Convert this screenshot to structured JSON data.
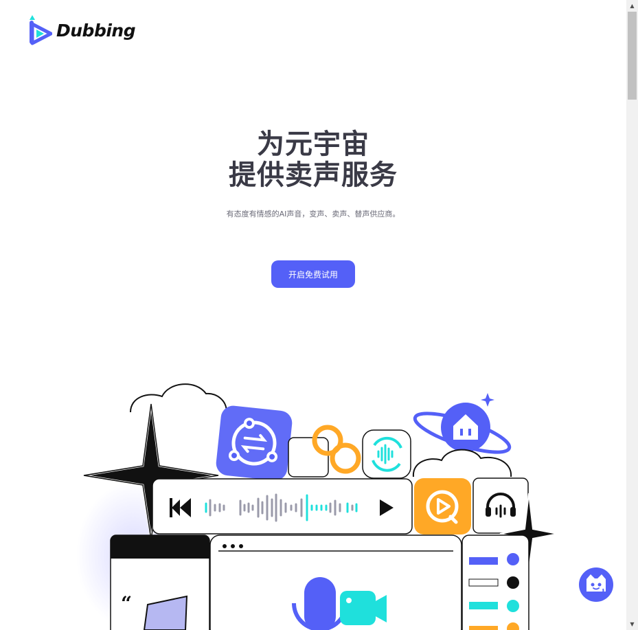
{
  "brand": {
    "name": "Dubbing"
  },
  "hero": {
    "title_line1": "为元宇宙",
    "title_line2": "提供卖声服务",
    "subtitle": "有态度有情感的AI声音，变声、卖声、替声供应商。",
    "cta_label": "开启免费试用"
  },
  "colors": {
    "brand": "#5460f7",
    "text_dark": "#3a3a46",
    "cyan": "#1fe0dc",
    "orange": "#ffa826",
    "black": "#111111"
  },
  "icons": {
    "logo": "play-triangle-logo",
    "convert": "swap-circle-icon",
    "link": "infinity-link-icon",
    "voice": "voice-refresh-icon",
    "home": "planet-home-icon",
    "prev": "skip-previous-icon",
    "play": "play-icon",
    "media": "play-circle-icon",
    "headphones": "headphones-icon",
    "mic": "microphone-icon",
    "camera": "video-camera-icon",
    "chat": "cat-assistant-icon"
  }
}
